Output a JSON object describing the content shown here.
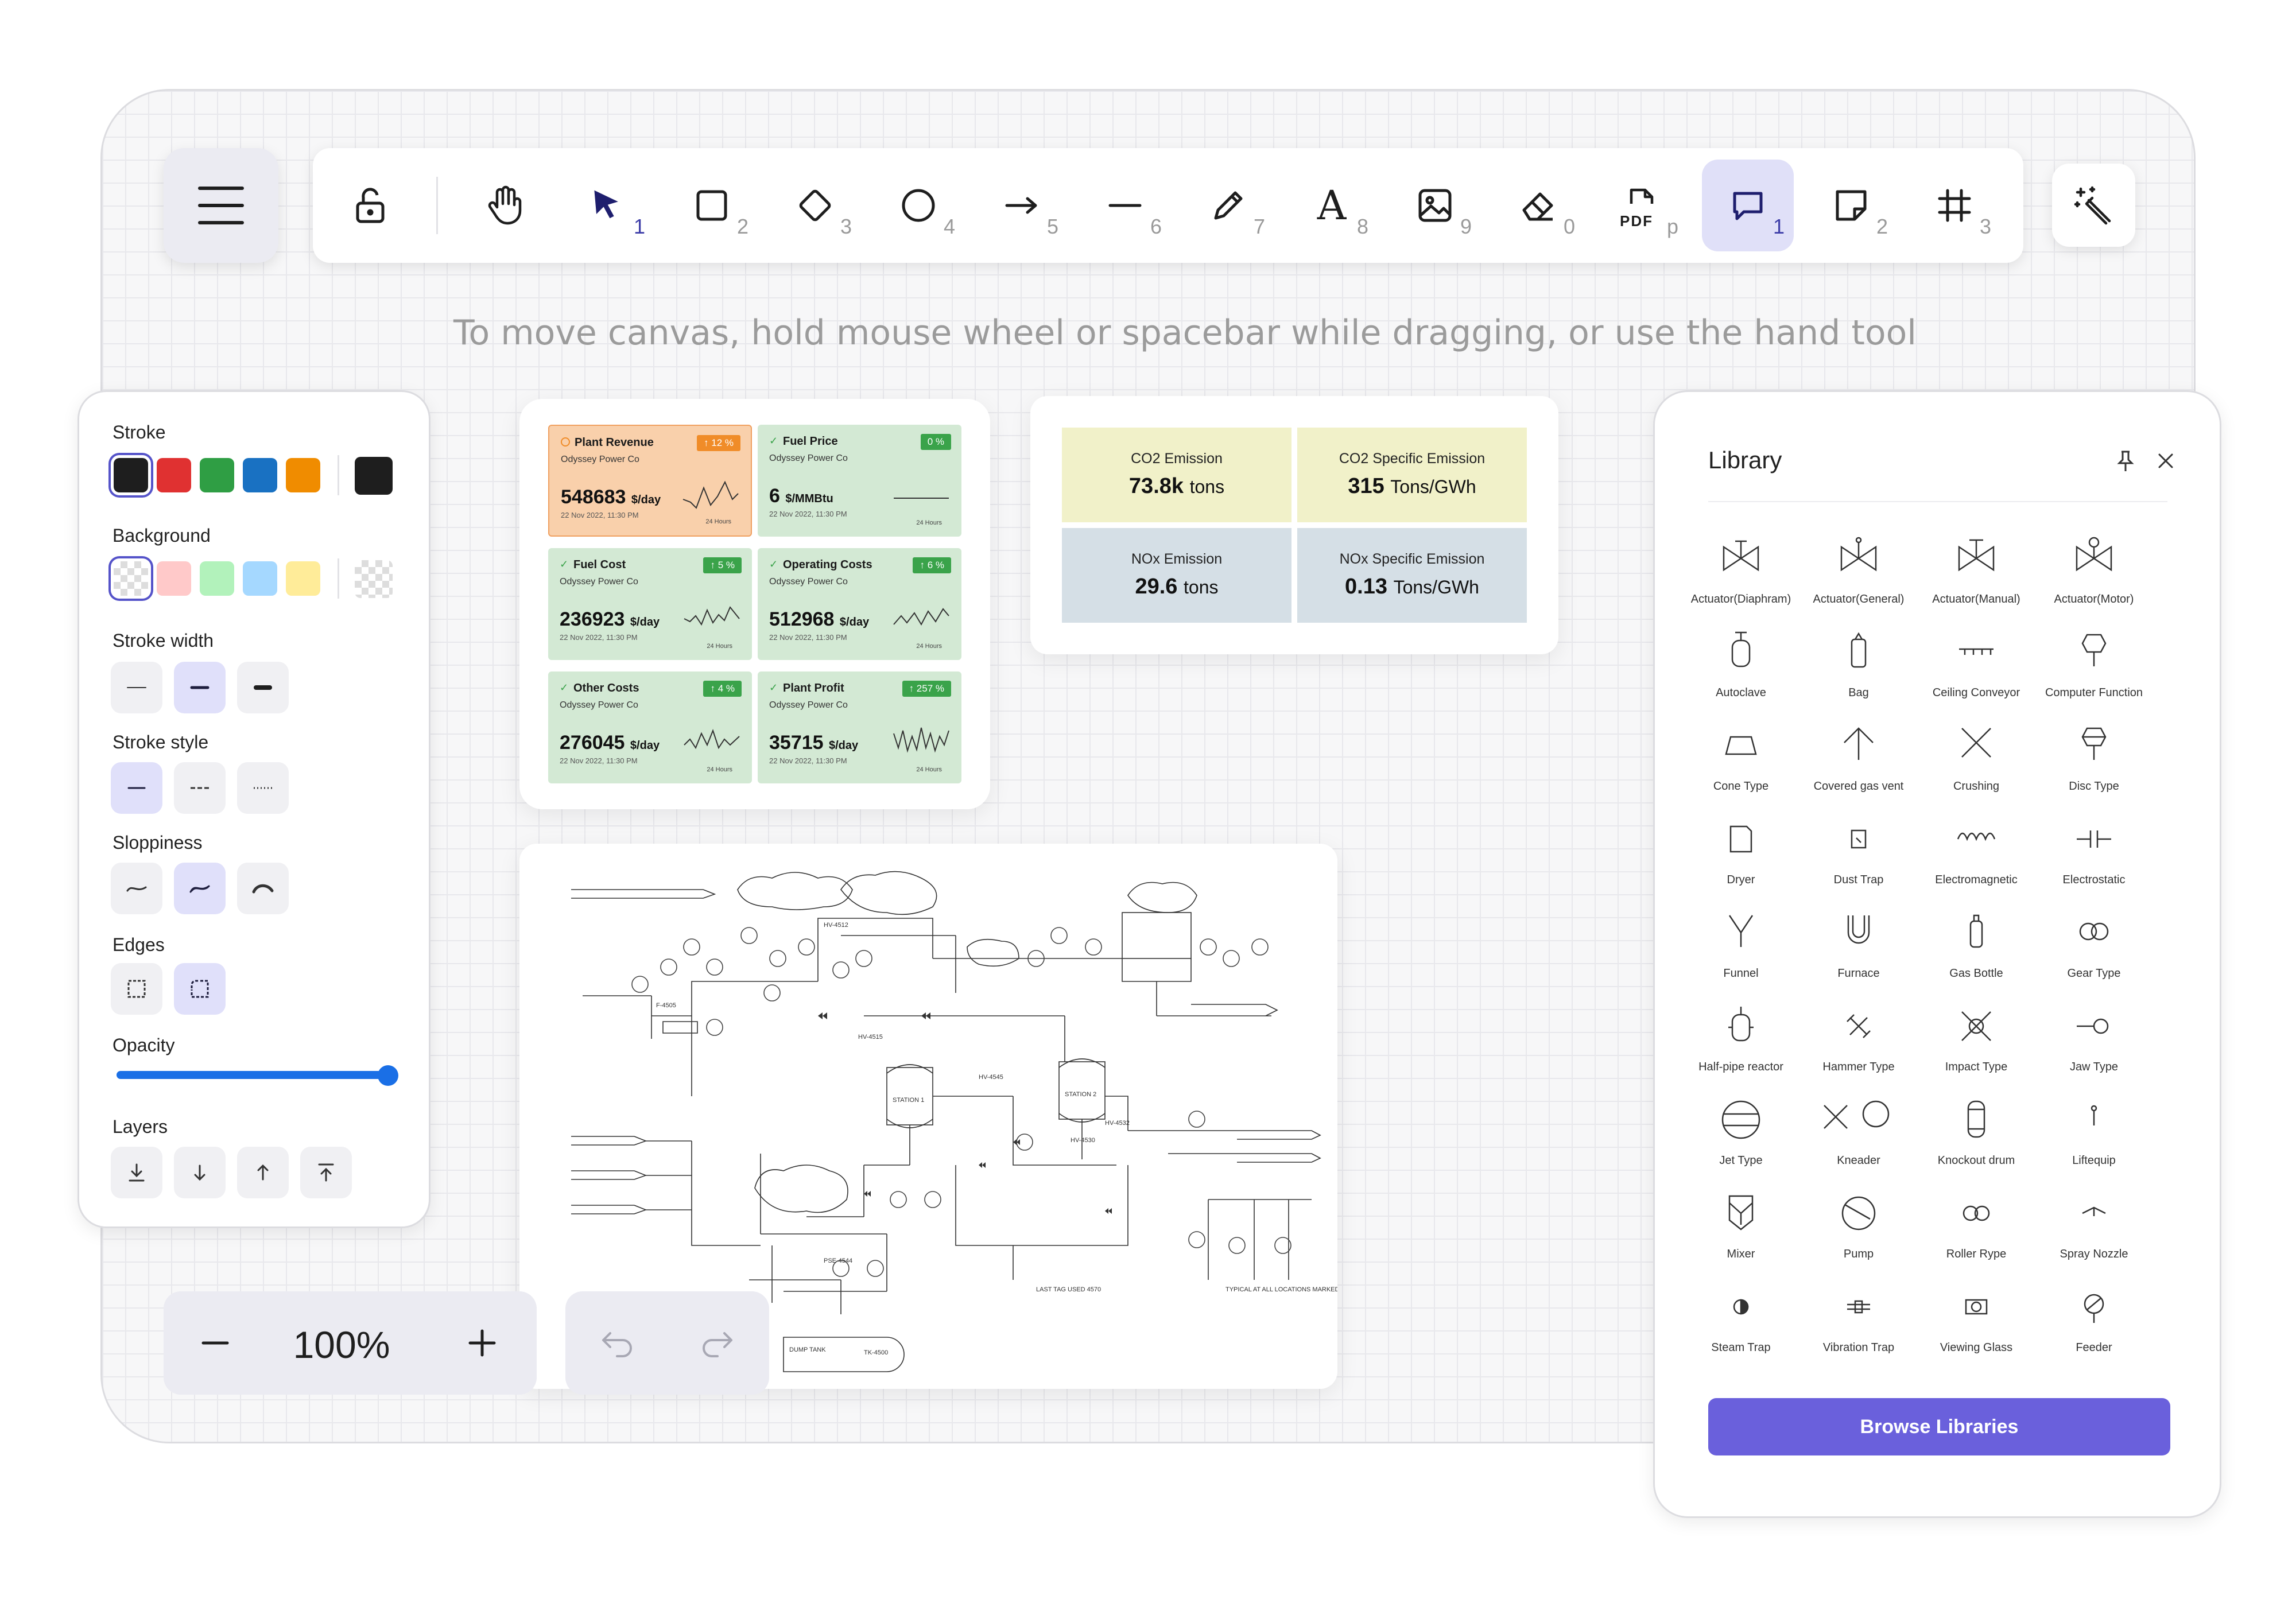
{
  "toolbar": {
    "tools": [
      {
        "name": "lock",
        "key": ""
      },
      {
        "name": "hand",
        "key": ""
      },
      {
        "name": "selection",
        "key": "1"
      },
      {
        "name": "rectangle",
        "key": "2"
      },
      {
        "name": "diamond",
        "key": "3"
      },
      {
        "name": "ellipse",
        "key": "4"
      },
      {
        "name": "arrow",
        "key": "5"
      },
      {
        "name": "line",
        "key": "6"
      },
      {
        "name": "draw",
        "key": "7"
      },
      {
        "name": "text",
        "key": "8"
      },
      {
        "name": "image",
        "key": "9"
      },
      {
        "name": "eraser",
        "key": "0"
      },
      {
        "name": "pdf",
        "key": "p"
      },
      {
        "name": "comment",
        "key": "1"
      },
      {
        "name": "sticky-note",
        "key": "2"
      },
      {
        "name": "frame",
        "key": "3"
      }
    ],
    "pdf_glyph": "PDF",
    "text_glyph": "A"
  },
  "hint": "To move canvas, hold mouse wheel or spacebar while dragging, or use the hand tool",
  "properties": {
    "stroke_label": "Stroke",
    "stroke_colors": [
      "#1e1e1e",
      "#e03131",
      "#2f9e44",
      "#1971c2",
      "#f08c00"
    ],
    "stroke_current": "#1e1e1e",
    "background_label": "Background",
    "background_colors": [
      "transparent",
      "#ffc9c9",
      "#b2f2bb",
      "#a5d8ff",
      "#ffec99"
    ],
    "stroke_width_label": "Stroke width",
    "stroke_style_label": "Stroke style",
    "sloppiness_label": "Sloppiness",
    "edges_label": "Edges",
    "opacity_label": "Opacity",
    "opacity_value": 100,
    "layers_label": "Layers"
  },
  "zoom": {
    "value": "100%",
    "minus": "−",
    "plus": "+"
  },
  "dashboard": {
    "cards": [
      {
        "title": "Plant Revenue",
        "company": "Odyssey Power Co",
        "value": "548683",
        "unit": "$/day",
        "date": "22 Nov 2022, 11:30 PM",
        "badge": "↑ 12 %",
        "hours": "24 Hours",
        "color": "#f9d0ab",
        "badge_color": "#f08c28"
      },
      {
        "title": "Fuel Price",
        "company": "Odyssey Power Co",
        "value": "6",
        "unit": "$/MMBtu",
        "date": "22 Nov 2022, 11:30 PM",
        "badge": "0 %",
        "hours": "24 Hours",
        "color": "#d3e9d4",
        "badge_color": "#3aa34a"
      },
      {
        "title": "Fuel Cost",
        "company": "Odyssey Power Co",
        "value": "236923",
        "unit": "$/day",
        "date": "22 Nov 2022, 11:30 PM",
        "badge": "↑ 5 %",
        "hours": "24 Hours",
        "color": "#d3e9d4",
        "badge_color": "#3aa34a"
      },
      {
        "title": "Operating Costs",
        "company": "Odyssey Power Co",
        "value": "512968",
        "unit": "$/day",
        "date": "22 Nov 2022, 11:30 PM",
        "badge": "↑ 6 %",
        "hours": "24 Hours",
        "color": "#d3e9d4",
        "badge_color": "#3aa34a"
      },
      {
        "title": "Other Costs",
        "company": "Odyssey Power Co",
        "value": "276045",
        "unit": "$/day",
        "date": "22 Nov 2022, 11:30 PM",
        "badge": "↑ 4 %",
        "hours": "24 Hours",
        "color": "#d3e9d4",
        "badge_color": "#3aa34a"
      },
      {
        "title": "Plant Profit",
        "company": "Odyssey Power Co",
        "value": "35715",
        "unit": "$/day",
        "date": "22 Nov 2022, 11:30 PM",
        "badge": "↑ 257 %",
        "hours": "24 Hours",
        "color": "#d3e9d4",
        "badge_color": "#3aa34a"
      }
    ]
  },
  "emissions": [
    {
      "title": "CO2 Emission",
      "value": "73.8k",
      "unit": "tons",
      "color": "#f1f1c9"
    },
    {
      "title": "CO2 Specific Emission",
      "value": "315",
      "unit": "Tons/GWh",
      "color": "#f1f1c9"
    },
    {
      "title": "NOx Emission",
      "value": "29.6",
      "unit": "tons",
      "color": "#d5dfe6"
    },
    {
      "title": "NOx Specific Emission",
      "value": "0.13",
      "unit": "Tons/GWh",
      "color": "#d5dfe6"
    }
  ],
  "diagram": {
    "labels": [
      "STATION 1",
      "STATION 2",
      "DUMP TANK",
      "TK-4500",
      "LAST TAG USED 4570",
      "TYPICAL AT ALL LOCATIONS MARKED",
      "F-4505",
      "PSE-4544",
      "HV-4512",
      "HV-4515",
      "HV-4530",
      "HV-4532",
      "HV-4545"
    ]
  },
  "library": {
    "title": "Library",
    "items": [
      "Actuator(Diaphram)",
      "Actuator(General)",
      "Actuator(Manual)",
      "Actuator(Motor)",
      "Autoclave",
      "Bag",
      "Ceiling Conveyor",
      "Computer Function",
      "Cone Type",
      "Covered gas vent",
      "Crushing",
      "Disc Type",
      "Dryer",
      "Dust Trap",
      "Electromagnetic",
      "Electrostatic",
      "Funnel",
      "Furnace",
      "Gas Bottle",
      "Gear Type",
      "Half-pipe reactor",
      "Hammer Type",
      "Impact Type",
      "Jaw Type",
      "Jet Type",
      "Kneader",
      "Knockout drum",
      "Liftequip",
      "Mixer",
      "Pump",
      "Roller Rype",
      "Spray Nozzle",
      "Steam Trap",
      "Vibration Trap",
      "Viewing Glass",
      "Feeder"
    ],
    "browse_label": "Browse Libraries"
  },
  "colors": {
    "accent": "#6a60dc",
    "selection": "#5553c9"
  }
}
